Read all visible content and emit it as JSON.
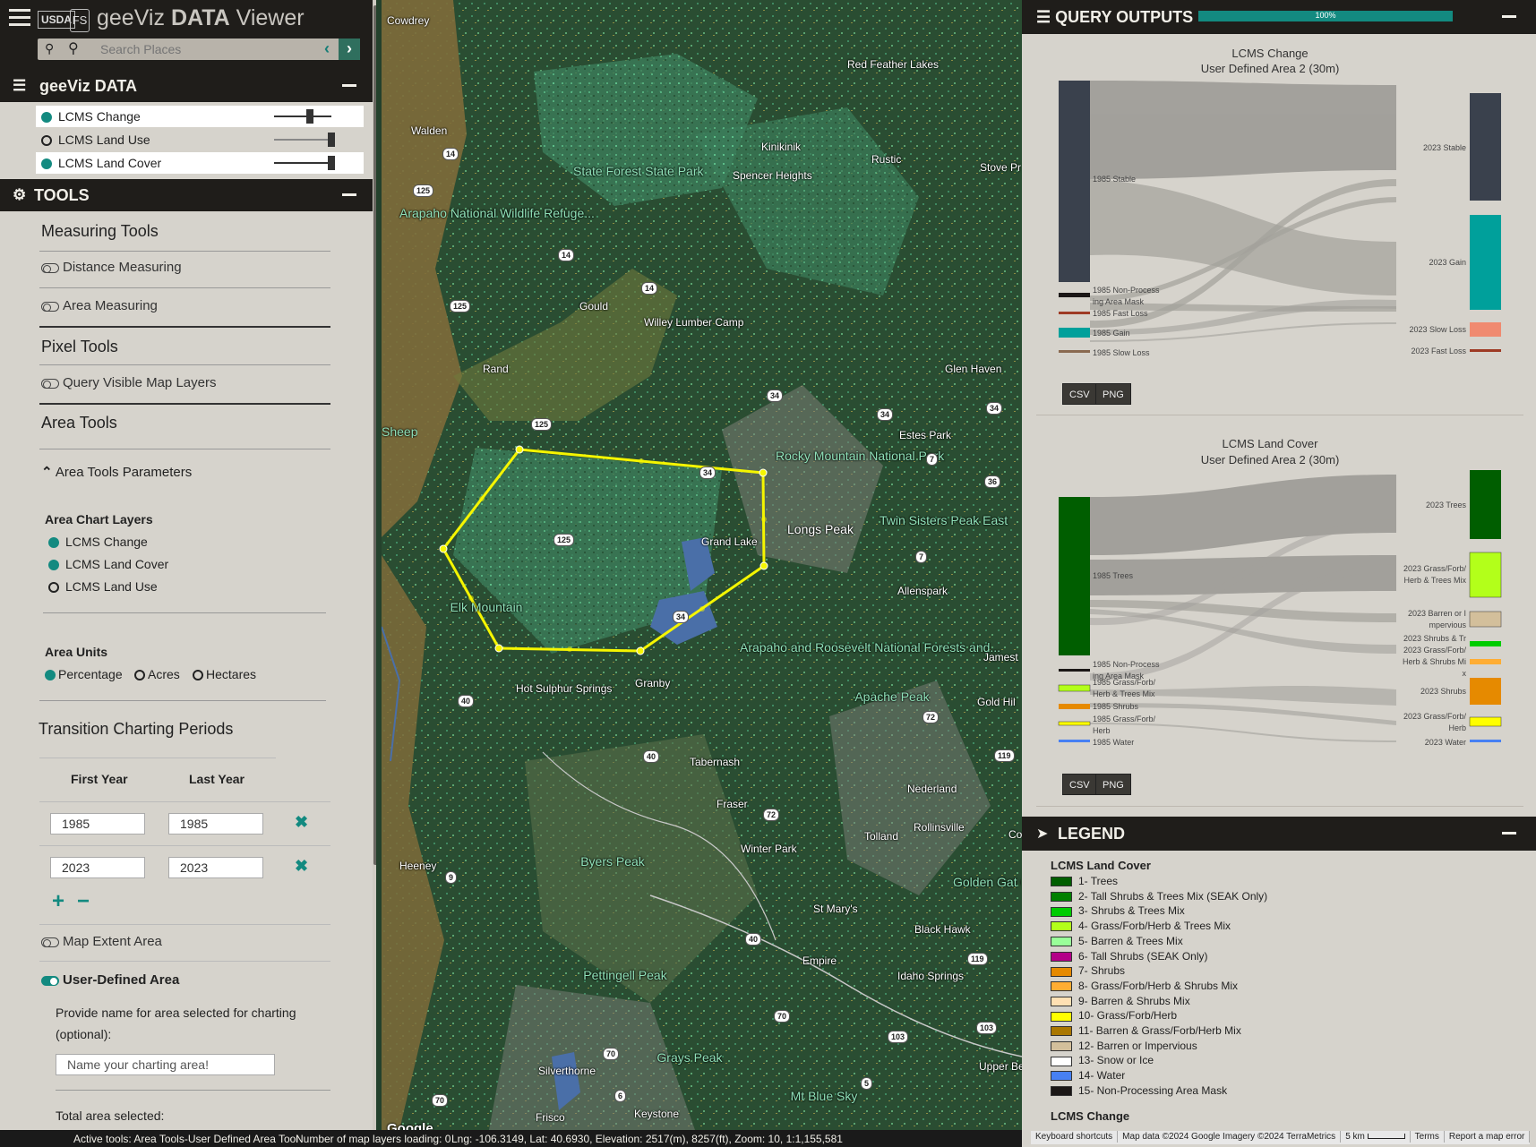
{
  "app": {
    "agency1": "USDA",
    "agency2": "FS",
    "title_pre": "geeViz ",
    "title_bold": "DATA",
    "title_post": " Viewer",
    "search_placeholder": "Search Places",
    "menu_icon": "hamburger-icon",
    "pin_icon": "location-pin-icon",
    "search_icon": "search-icon"
  },
  "data_panel": {
    "title": "geeViz DATA",
    "layers": [
      {
        "name": "LCMS Change",
        "visible": true,
        "opacity": 0.6
      },
      {
        "name": "LCMS Land Use",
        "visible": false,
        "opacity": 1.0
      },
      {
        "name": "LCMS Land Cover",
        "visible": true,
        "opacity": 1.0
      }
    ]
  },
  "tools": {
    "title": "TOOLS",
    "measuring_head": "Measuring Tools",
    "distance": "Distance Measuring",
    "area": "Area Measuring",
    "pixel_head": "Pixel Tools",
    "query": "Query Visible Map Layers",
    "area_tools_head": "Area Tools",
    "params_head": "Area Tools Parameters",
    "chart_layers_head": "Area Chart Layers",
    "chart_layers": [
      {
        "name": "LCMS Change",
        "on": true
      },
      {
        "name": "LCMS Land Cover",
        "on": true
      },
      {
        "name": "LCMS Land Use",
        "on": false
      }
    ],
    "units_head": "Area Units",
    "units": [
      {
        "name": "Percentage",
        "on": true
      },
      {
        "name": "Acres",
        "on": false
      },
      {
        "name": "Hectares",
        "on": false
      }
    ],
    "transition_head": "Transition Charting Periods",
    "first_year_head": "First Year",
    "last_year_head": "Last Year",
    "periods": [
      {
        "first": "1985",
        "last": "1985"
      },
      {
        "first": "2023",
        "last": "2023"
      }
    ],
    "add": "+",
    "remove": "−",
    "map_extent": "Map Extent Area",
    "user_defined": "User-Defined Area",
    "name_prompt": "Provide name for area selected for charting (optional):",
    "name_placeholder": "Name your charting area!",
    "total_area": "Total area selected:"
  },
  "map": {
    "labels": [
      "Cowdrey",
      "Walden",
      "Red Feather Lakes",
      "Kinikinik",
      "Rustic",
      "Stove Pr Landi",
      "Spencer Heights",
      "Gould",
      "Willey Lumber Camp",
      "Rand",
      "Glen Haven",
      "Estes Park",
      "Grand Lake",
      "Longs Peak",
      "Allenspark",
      "Granby",
      "Hot Sulphur Springs",
      "Tabernash",
      "Jamest",
      "Gold Hil",
      "Fraser",
      "Nederland",
      "Tolland",
      "Rollinsville",
      "Winter Park",
      "Heeney",
      "St Mary's",
      "Black Hawk",
      "Empire",
      "Idaho Springs",
      "Silverthorne",
      "Upper Bear Creek",
      "Frisco",
      "Keystone",
      "Co"
    ],
    "parks": [
      "State Forest State Park",
      "Arapaho National Wildlife Refuge...",
      "Rocky Mountain National Park",
      "Twin Sisters Peak East",
      "Arapaho and Roosevelt National Forests and...",
      "Golden Gat Canyon State Park"
    ],
    "peaks": [
      "Sheep Mountain",
      "Elk Mountain",
      "Apache Peak",
      "Byers Peak",
      "Pettingell Peak",
      "Grays Peak",
      "Mt Blue Sky"
    ],
    "google": "Google"
  },
  "query": {
    "title": "QUERY OUTPUTS",
    "progress": "100%",
    "progress_value": 1.0,
    "chart1": {
      "title": "LCMS Change",
      "subtitle": "User Defined Area 2 (30m)",
      "left_nodes": [
        "1985 Stable",
        "1985 Non-Process",
        "ing Area Mask",
        "1985 Fast Loss",
        "1985 Gain",
        "1985 Slow Loss"
      ],
      "right_nodes": [
        "2023 Stable",
        "2023 Gain",
        "2023 Slow Loss",
        "2023 Fast Loss"
      ]
    },
    "chart2": {
      "title": "LCMS Land Cover",
      "subtitle": "User Defined Area 2 (30m)",
      "left_nodes": [
        "1985 Trees",
        "1985 Non-Process",
        "ing Area Mask",
        "1985 Grass/Forb/",
        "Herb & Trees Mix",
        "1985 Shrubs",
        "1985 Grass/Forb/",
        "Herb",
        "1985 Water"
      ],
      "right_nodes": [
        "2023 Trees",
        "2023 Grass/Forb/",
        "Herb & Trees Mix",
        "2023 Barren or I",
        "mpervious",
        "2023 Shrubs & Tr",
        "2023 Grass/Forb/",
        "Herb & Shrubs Mi",
        "x",
        "2023 Shrubs",
        "2023 Grass/Forb/",
        "Herb",
        "2023 Water"
      ]
    },
    "csv": "CSV",
    "png": "PNG"
  },
  "legend": {
    "title": "LEGEND",
    "section": "LCMS Land Cover",
    "items": [
      {
        "label": "1- Trees",
        "color": "#005e00"
      },
      {
        "label": "2- Tall Shrubs & Trees Mix (SEAK Only)",
        "color": "#008000"
      },
      {
        "label": "3- Shrubs & Trees Mix",
        "color": "#00cc00"
      },
      {
        "label": "4- Grass/Forb/Herb & Trees Mix",
        "color": "#b3ff1a"
      },
      {
        "label": "5- Barren & Trees Mix",
        "color": "#99ff99"
      },
      {
        "label": "6- Tall Shrubs (SEAK Only)",
        "color": "#b30088"
      },
      {
        "label": "7- Shrubs",
        "color": "#e68a00"
      },
      {
        "label": "8- Grass/Forb/Herb & Shrubs Mix",
        "color": "#ffad33"
      },
      {
        "label": "9- Barren & Shrubs Mix",
        "color": "#ffe0b3"
      },
      {
        "label": "10- Grass/Forb/Herb",
        "color": "#ffff00"
      },
      {
        "label": "11- Barren & Grass/Forb/Herb Mix",
        "color": "#aa7700"
      },
      {
        "label": "12- Barren or Impervious",
        "color": "#d3bf9b"
      },
      {
        "label": "13- Snow or Ice",
        "color": "#ffffff"
      },
      {
        "label": "14- Water",
        "color": "#4780f3"
      },
      {
        "label": "15- Non-Processing Area Mask",
        "color": "#1b1716"
      }
    ],
    "next_section": "LCMS Change"
  },
  "status": {
    "active_tools": "Active tools: Area Tools-User Defined Area Tool",
    "layers_loading": "Number of map layers loading: 0",
    "coords": "Lng: -106.3149, Lat: 40.6930, Elevation: 2517(m), 8257(ft), Zoom: 10, 1:1,155,581"
  },
  "attribution": {
    "shortcuts": "Keyboard shortcuts",
    "mapdata": "Map data ©2024 Google Imagery ©2024 TerraMetrics",
    "scale": "5 km",
    "terms": "Terms",
    "report": "Report a map error"
  }
}
